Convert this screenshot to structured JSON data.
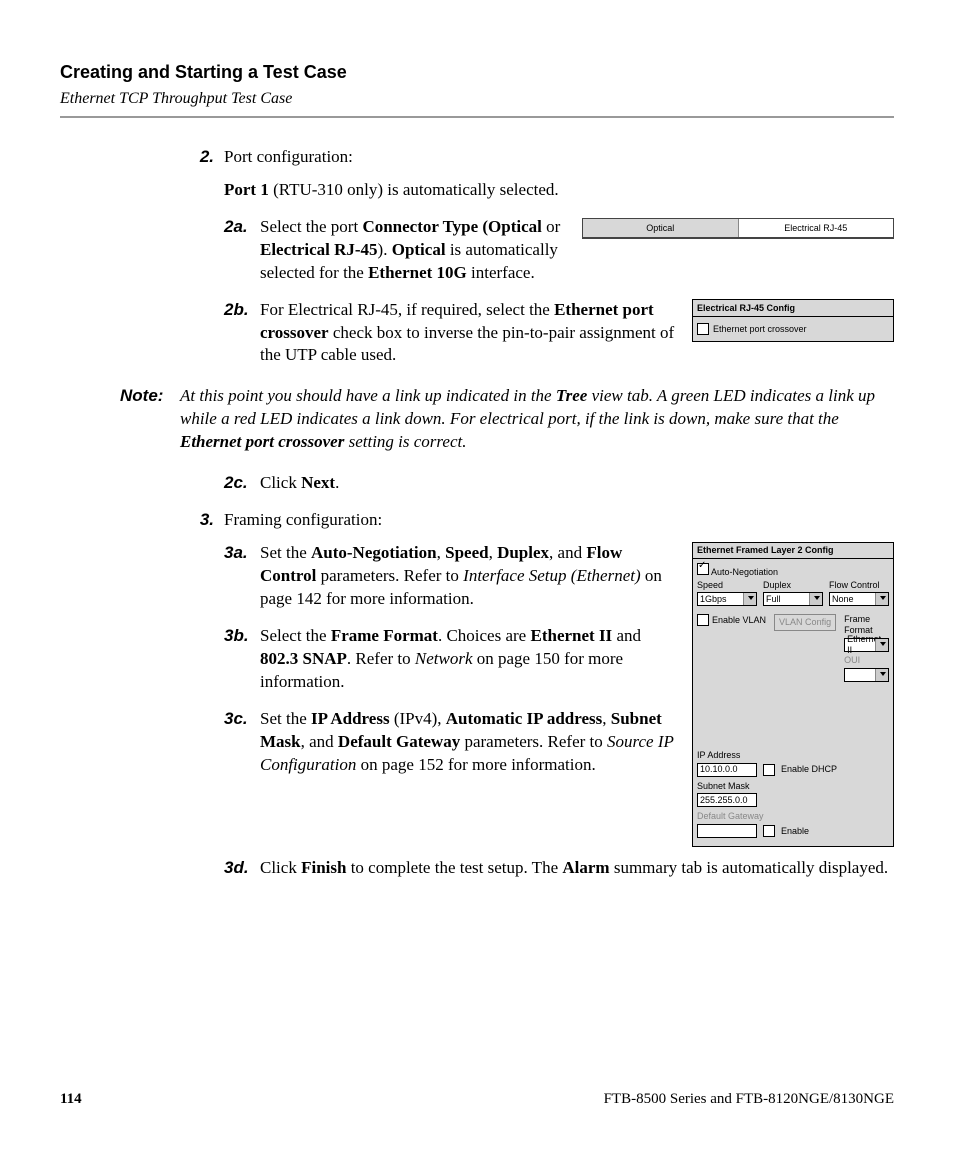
{
  "header": {
    "title": "Creating and Starting a Test Case",
    "subtitle": "Ethernet TCP Throughput Test Case"
  },
  "step2": {
    "num": "2.",
    "intro": "Port configuration:",
    "port1_prefix": "Port 1",
    "port1_rest": " (RTU-310 only) is automatically selected."
  },
  "s2a": {
    "num": "2a.",
    "t1": "Select the port ",
    "b1": "Connector Type (Optical",
    "t2": " or ",
    "b2": "Electrical RJ-45",
    "t3": "). ",
    "b3": "Optical",
    "t4": " is automatically selected for the ",
    "b4": "Ethernet 10G",
    "t5": " interface."
  },
  "connector_tabs": {
    "left": "Optical",
    "right": "Electrical RJ-45"
  },
  "s2b": {
    "num": "2b.",
    "t1": "For Electrical RJ-45, if required, select the ",
    "b1": "Ethernet port crossover",
    "t2": " check box to inverse the pin-to-pair assignment of the UTP cable used."
  },
  "rj45": {
    "hdr": "Electrical RJ-45 Config",
    "opt": "Ethernet port crossover"
  },
  "note": {
    "label": "Note:",
    "t1": "At this point you should have a link up indicated in the ",
    "b1": "Tree",
    "t2": " view tab. A green LED indicates a link up while a red LED indicates a link down. For electrical port, if the link is down, make sure that the ",
    "b2": "Ethernet port crossover",
    "t3": " setting is correct."
  },
  "s2c": {
    "num": "2c.",
    "t1": "Click ",
    "b1": "Next",
    "t2": "."
  },
  "step3": {
    "num": "3.",
    "intro": "Framing configuration:"
  },
  "s3a": {
    "num": "3a.",
    "t1": "Set the ",
    "b1": "Auto-Negotiation",
    "c1": ", ",
    "b2": "Speed",
    "c2": ", ",
    "b3": "Duplex",
    "c3": ", and ",
    "b4": "Flow Control",
    "t2": " parameters. Refer to ",
    "i1": "Interface Setup (Ethernet)",
    "t3": " on page 142 for more information."
  },
  "s3b": {
    "num": "3b.",
    "t1": "Select the ",
    "b1": "Frame Format",
    "t2": ". Choices are ",
    "b2": "Ethernet II",
    "t3": " and ",
    "b3": "802.3 SNAP",
    "t4": ". Refer to ",
    "i1": "Network",
    "t5": " on page 150 for more information."
  },
  "s3c": {
    "num": "3c.",
    "t1": "Set the ",
    "b1": "IP Address",
    "t2": " (IPv4), ",
    "b2": "Automatic IP address",
    "c1": ", ",
    "b3": "Subnet Mask",
    "c2": ", and ",
    "b4": "Default Gateway",
    "t3": " parameters. Refer to ",
    "i1": "Source IP Configuration",
    "t4": " on page 152 for more information."
  },
  "s3d": {
    "num": "3d.",
    "t1": "Click ",
    "b1": "Finish",
    "t2": " to complete the test setup. The ",
    "b2": "Alarm",
    "t3": " summary tab is automatically displayed."
  },
  "l2": {
    "hdr": "Ethernet Framed Layer 2 Config",
    "autoneg": "Auto-Negotiation",
    "speed_lbl": "Speed",
    "speed_val": "1Gbps",
    "duplex_lbl": "Duplex",
    "duplex_val": "Full",
    "flow_lbl": "Flow Control",
    "flow_val": "None",
    "enable_vlan": "Enable VLAN",
    "vlan_btn": "VLAN Config",
    "frame_lbl": "Frame Format",
    "frame_val": "Ethernet II",
    "oui_lbl": "OUI",
    "ip_lbl": "IP Address",
    "ip_val": "10.10.0.0",
    "enable_dhcp": "Enable DHCP",
    "subnet_lbl": "Subnet Mask",
    "subnet_val": "255.255.0.0",
    "gw_lbl": "Default Gateway",
    "gw_enable": "Enable"
  },
  "footer": {
    "page": "114",
    "doc": "FTB-8500 Series and FTB-8120NGE/8130NGE"
  }
}
